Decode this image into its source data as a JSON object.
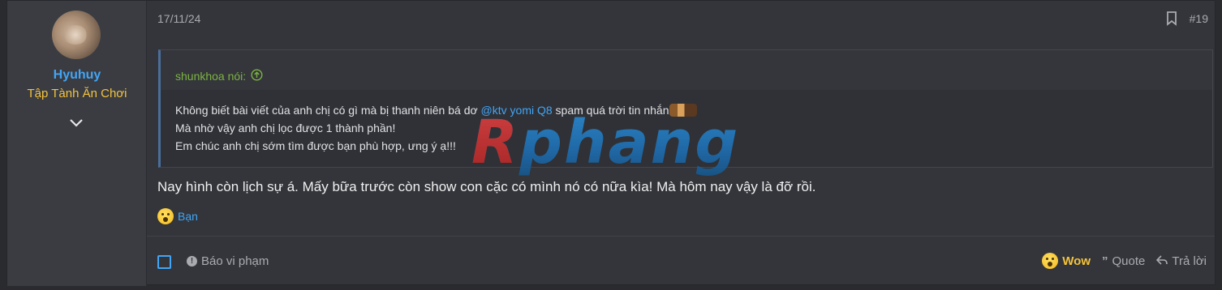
{
  "user": {
    "name": "Hyuhuy",
    "title": "Tập Tành Ăn Chơi"
  },
  "post": {
    "date": "17/11/24",
    "number": "#19",
    "quote": {
      "author_label": "shunkhoa nói:",
      "line1_before": "Không biết bài viết của anh chị có gì mà bị thanh niên bá dơ ",
      "mention": "@ktv yomi Q8",
      "line1_after": " spam quá trời tin nhắn",
      "line2": "Mà nhờ vậy anh chị lọc được 1 thành phần!",
      "line3": "Em chúc anh chị sớm tìm được bạn phù hợp, ưng ý ạ!!!"
    },
    "message": "Nay hình còn lịch sự á. Mấy bữa trước còn show con cặc có mình nó có nữa kìa! Mà hôm nay vậy là đỡ rồi.",
    "reaction_by": "Bạn"
  },
  "watermark": {
    "first": "R",
    "rest": "phang"
  },
  "footer": {
    "report_label": "Báo vi phạm",
    "wow_label": "Wow",
    "quote_label": "Quote",
    "reply_label": "Trả lời"
  },
  "colors": {
    "accent": "#42a5f5",
    "title": "#f5c33b",
    "quote_author": "#7cb342"
  }
}
